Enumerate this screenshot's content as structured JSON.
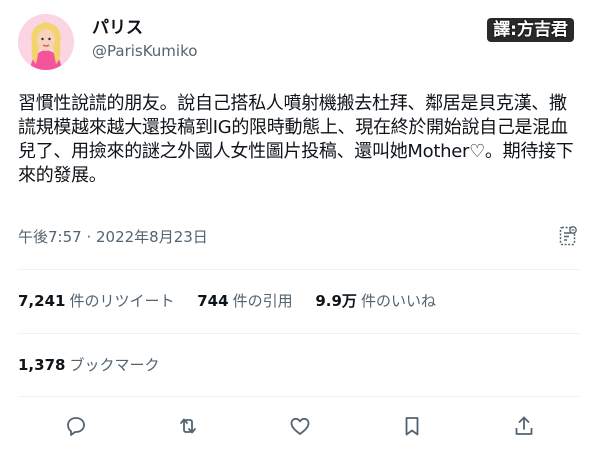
{
  "author": {
    "display_name": "パリス",
    "handle": "@ParisKumiko"
  },
  "watermark": "譯:方吉君",
  "tweet": {
    "text": "習慣性說謊的朋友。說自己搭私人噴射機搬去杜拜、鄰居是貝克漢、撒謊規模越來越大還投稿到IG的限時動態上、現在終於開始說自己是混血兒了、用撿來的謎之外國人女性圖片投稿、還叫她Mother♡。期待接下來的發展。",
    "timestamp": "午後7:57 · 2022年8月23日"
  },
  "stats": {
    "retweets_count": "7,241",
    "retweets_label": "件のリツイート",
    "quotes_count": "744",
    "quotes_label": "件の引用",
    "likes_count": "9.9万",
    "likes_label": "件のいいね",
    "bookmarks_count": "1,378",
    "bookmarks_label": "ブックマーク"
  },
  "icons": {
    "analytics": "analytics-icon",
    "reply": "reply-icon",
    "retweet": "retweet-icon",
    "like": "heart-icon",
    "bookmark": "bookmark-icon",
    "share": "share-icon"
  },
  "colors": {
    "icon": "#536471",
    "text": "#0f1419",
    "secondary": "#536471",
    "avatar_bg": "#fbd5e4"
  }
}
